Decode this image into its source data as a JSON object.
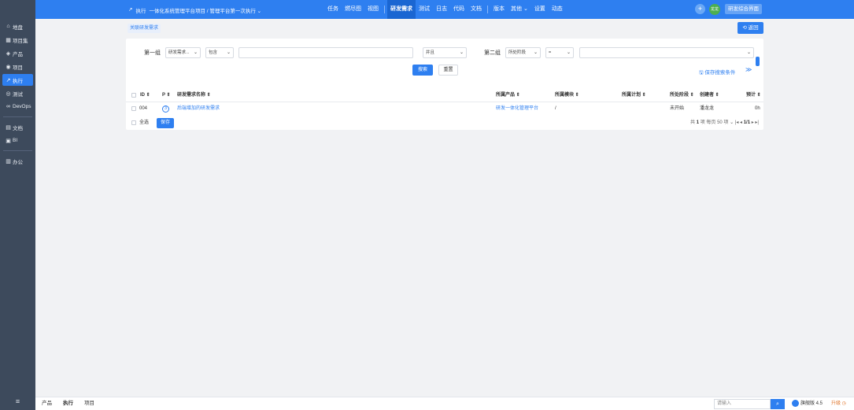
{
  "sidebar": {
    "items": [
      {
        "icon": "⌂",
        "label": "地盘",
        "active": false
      },
      {
        "icon": "▦",
        "label": "项目集",
        "active": false
      },
      {
        "icon": "◈",
        "label": "产品",
        "active": false
      },
      {
        "icon": "◉",
        "label": "项目",
        "active": false
      },
      {
        "icon": "↗",
        "label": "执行",
        "active": true
      },
      {
        "icon": "◎",
        "label": "测试",
        "active": false
      },
      {
        "icon": "∞",
        "label": "DevOps",
        "active": false
      },
      {
        "icon": "▤",
        "label": "文档",
        "active": false
      },
      {
        "icon": "▣",
        "label": "BI",
        "active": false
      },
      {
        "icon": "▥",
        "label": "办公",
        "active": false
      }
    ],
    "menu_icon": "≡"
  },
  "topbar": {
    "crumb_icon": "↗",
    "crumb_root": "执行",
    "crumb_project": "一体化系统管理平台项目 / 管理平台第一次执行 ⌄",
    "nav": [
      {
        "label": "任务",
        "active": false
      },
      {
        "label": "燃尽图",
        "active": false
      },
      {
        "label": "视图",
        "active": false
      },
      {
        "label": "研发需求",
        "active": true
      },
      {
        "label": "测试",
        "active": false
      },
      {
        "label": "日志",
        "active": false
      },
      {
        "label": "代码",
        "active": false
      },
      {
        "label": "文档",
        "active": false
      },
      {
        "label": "版本",
        "active": false
      },
      {
        "label": "其他 ⌄",
        "active": false
      },
      {
        "label": "设置",
        "active": false
      },
      {
        "label": "动态",
        "active": false
      }
    ],
    "plus": "+",
    "avatar_text": "龙龙",
    "switch_label": "研发综合界面"
  },
  "toolbar": {
    "link_story_label": "关联研发需求",
    "back_label": "⟲ 返回"
  },
  "search": {
    "group1_label": "第一组",
    "field1": "研发需求...",
    "op1": "包含",
    "value1": "",
    "and_or": "并且",
    "group2_label": "第二组",
    "field2": "所处阶段",
    "op2": "=",
    "value2": "",
    "search_btn": "搜索",
    "reset_btn": "重置",
    "save_condition": "保存搜索条件",
    "expand_icon": "≫"
  },
  "table": {
    "headers": {
      "id": "ID ⇕",
      "pri": "P ⇕",
      "name": "研发需求名称 ⇕",
      "product": "所属产品 ⇕",
      "module": "所属模块 ⇕",
      "plan": "所属计划 ⇕",
      "stage": "所处阶段 ⇕",
      "creator": "创建者 ⇕",
      "estimate": "预计 ⇕"
    },
    "rows": [
      {
        "id": "004",
        "pri": "3",
        "name": "后端增加的研发需求",
        "product": "研发一体化管理平台",
        "module": "/",
        "plan": "",
        "stage": "未开始",
        "creator": "潘龙龙",
        "estimate": "0h"
      }
    ],
    "select_all": "全选",
    "save": "保存",
    "pager": {
      "total_prefix": "共",
      "total": "1",
      "total_suffix": "项",
      "per_page": "每页 50 项 ⌄",
      "nav_first": "|◂",
      "nav_prev": "◂",
      "page": "1/1",
      "nav_next": "▸",
      "nav_last": "▸|"
    }
  },
  "bottombar": {
    "tabs": [
      {
        "label": "产品",
        "active": false
      },
      {
        "label": "执行",
        "active": true
      },
      {
        "label": "项目",
        "active": false
      }
    ],
    "search_placeholder": "请输入",
    "search_icon": "⌕",
    "version": "旗舰版 4.5",
    "upgrade": "升级 ◷"
  },
  "colors": {
    "primary": "#2e7ff0",
    "sidebar": "#3d4a5c",
    "upgrade": "#e0752a"
  }
}
